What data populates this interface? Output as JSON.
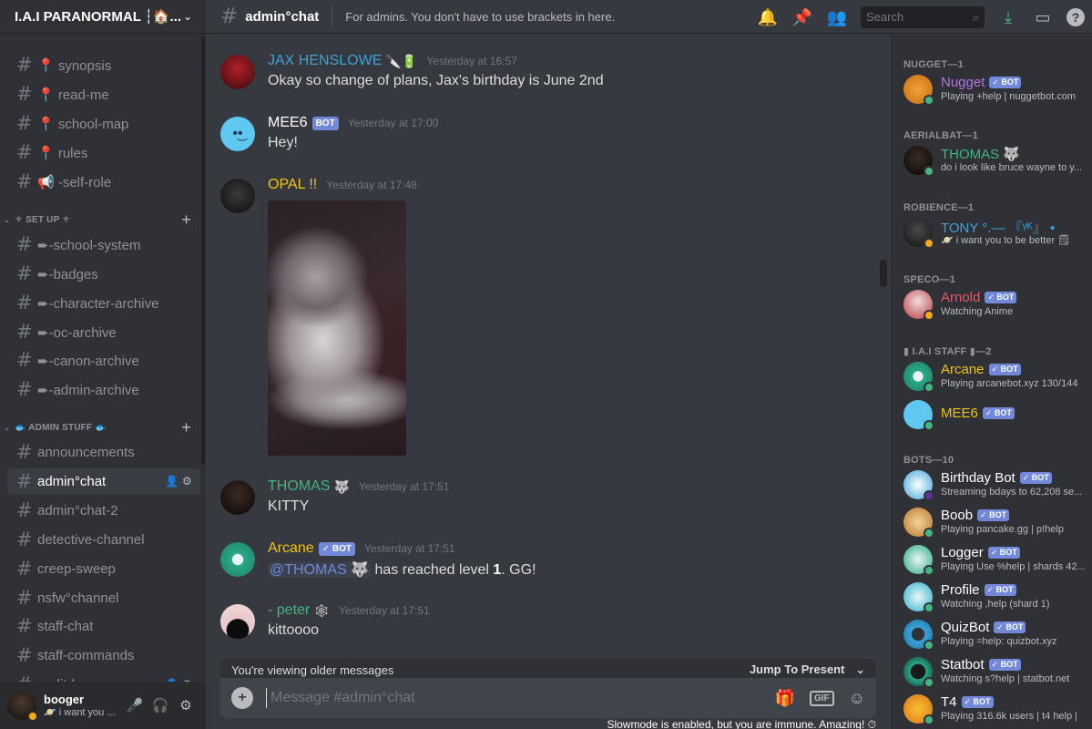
{
  "server": {
    "name": "I.A.I PARANORMAL ┆🏠...",
    "chevron": "⌄"
  },
  "channels": [
    {
      "label": "📍 synopsis"
    },
    {
      "label": "📍 read-me"
    },
    {
      "label": "📍 school-map"
    },
    {
      "label": "📍 rules"
    },
    {
      "label": "📢 -self-role"
    },
    {
      "label": "➨-school-system"
    },
    {
      "label": "➨-badges"
    },
    {
      "label": "➨-character-archive"
    },
    {
      "label": "➨-oc-archive"
    },
    {
      "label": "➨-canon-archive"
    },
    {
      "label": "➨-admin-archive"
    },
    {
      "label": "announcements"
    },
    {
      "label": "admin°chat"
    },
    {
      "label": "admin°chat-2"
    },
    {
      "label": "detective-channel"
    },
    {
      "label": "creep-sweep"
    },
    {
      "label": "nsfw°channel"
    },
    {
      "label": "staff-chat"
    },
    {
      "label": "staff-commands"
    },
    {
      "label": "audit-log"
    }
  ],
  "categories": [
    {
      "label": "⚜ SET UP ⚜"
    },
    {
      "label": "🐟 ADMIN STUFF 🐟"
    }
  ],
  "user": {
    "name": "booger",
    "status": "🪐 i want you ..."
  },
  "topbar": {
    "channel": "admin°chat",
    "topic": "For admins. You don't have to use brackets in here.",
    "search_placeholder": "Search"
  },
  "messages": [
    {
      "author": "JAX HENSLOWE",
      "emoji": "🔪🔋",
      "time": "Yesterday at 16:57",
      "text": "Okay so change of plans, Jax's birthday is June 2nd",
      "color": "#3ba3d8"
    },
    {
      "author": "MEE6",
      "bot": "BOT",
      "time": "Yesterday at 17:00",
      "text": "Hey!",
      "color": "#ffffff"
    },
    {
      "author": "OPAL !!",
      "time": "Yesterday at 17:48",
      "color": "#f1c40f"
    },
    {
      "author": "THOMAS",
      "emoji": "🐺",
      "time": "Yesterday at 17:51",
      "text": "KITTY",
      "color": "#43b581"
    },
    {
      "author": "Arcane",
      "bot": "✓ BOT",
      "time": "Yesterday at 17:51",
      "mention": "@THOMAS 🐺",
      "text_a": " has reached level ",
      "text_b": "1",
      "text_c": ". GG!",
      "color": "#f1c40f"
    },
    {
      "author": "- peter",
      "emoji": "🕸",
      "time": "Yesterday at 17:51",
      "text": "kittoooo",
      "color": "#43b581"
    }
  ],
  "older_banner": {
    "text": "You're viewing older messages",
    "jump": "Jump To Present"
  },
  "composer": {
    "placeholder": "Message #admin°chat",
    "gif": "GIF"
  },
  "slowmode": "Slowmode is enabled, but you are immune. Amazing!",
  "members": {
    "roles": [
      {
        "label": "NUGGET—1"
      },
      {
        "label": "AERIALBAT—1"
      },
      {
        "label": "ROBIENCE—1"
      },
      {
        "label": "SPECO—1"
      },
      {
        "label": "▮ I.A.I STAFF ▮—2"
      },
      {
        "label": "BOTS—10"
      }
    ],
    "list": [
      {
        "name": "Nugget",
        "bot": "✓ BOT",
        "activity": "Playing +help | nuggetbot.com",
        "color": "#b476e0"
      },
      {
        "name": "THOMAS 🐺",
        "activity": "do i look like bruce wayne to y...",
        "color": "#43b581"
      },
      {
        "name": "TONY °.— 『ᵞᴷ』 •",
        "activity": "🪐 i want you to be better 🗒",
        "color": "#3ba3d8"
      },
      {
        "name": "Arnold",
        "bot": "✓ BOT",
        "activity": "Watching Anime",
        "color": "#e05a6a"
      },
      {
        "name": "Arcane",
        "bot": "✓ BOT",
        "activity": "Playing arcanebot.xyz 130/144",
        "color": "#f1c40f"
      },
      {
        "name": "MEE6",
        "bot": "✓ BOT",
        "activity": "",
        "color": "#f1c40f"
      },
      {
        "name": "Birthday Bot",
        "bot": "✓ BOT",
        "activity": "Streaming bdays to 62,208 se...",
        "color": "#ffffff"
      },
      {
        "name": "Boob",
        "bot": "✓ BOT",
        "activity": "Playing pancake.gg | p!help",
        "color": "#ffffff"
      },
      {
        "name": "Logger",
        "bot": "✓ BOT",
        "activity": "Playing Use %help | shards 42...",
        "color": "#ffffff"
      },
      {
        "name": "Profile",
        "bot": "✓ BOT",
        "activity": "Watching ,help (shard 1)",
        "color": "#ffffff"
      },
      {
        "name": "QuizBot",
        "bot": "✓ BOT",
        "activity": "Playing =help: quizbot.xyz",
        "color": "#ffffff"
      },
      {
        "name": "Statbot",
        "bot": "✓ BOT",
        "activity": "Watching s?help | statbot.net",
        "color": "#ffffff"
      },
      {
        "name": "T4",
        "bot": "✓ BOT",
        "activity": "Playing 316.6k users | t4 help |",
        "color": "#ffffff"
      }
    ]
  },
  "colors": {
    "accent": "#7289da",
    "online": "#43b581",
    "idle": "#faa61a"
  }
}
